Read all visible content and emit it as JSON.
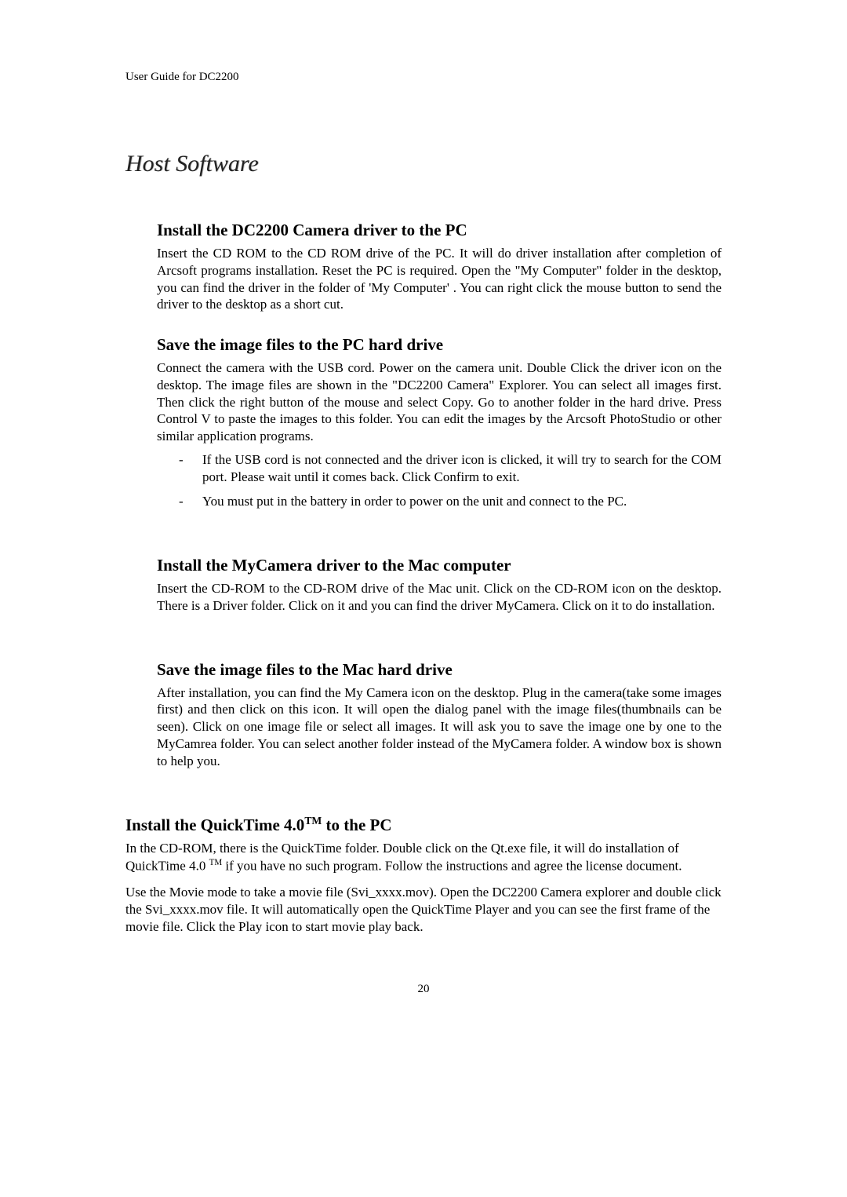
{
  "running_head": "User Guide for DC2200",
  "chapter_title": "Host Software",
  "sections": {
    "s1": {
      "heading": "Install the DC2200 Camera driver to the PC",
      "body": "Insert the CD ROM to the CD ROM drive of the PC. It will do driver installation after completion of Arcsoft programs installation. Reset the PC is required. Open the \"My Computer\" folder in the desktop, you can find the driver in the folder of 'My Computer' . You can right click the mouse button to send the driver to the desktop as a short cut."
    },
    "s2": {
      "heading": "Save the image files to the PC hard drive",
      "body": "Connect the camera with the USB cord. Power on the camera unit. Double Click the driver icon on the desktop. The image files are shown in the \"DC2200 Camera\" Explorer. You can select all images first. Then click the right button of the mouse and select Copy. Go to another folder in the hard drive. Press Control V to paste the images to this folder. You can edit the images by the Arcsoft PhotoStudio or other similar application programs.",
      "bullets": [
        "If the USB cord is not connected and the driver icon is clicked, it will try to search for the COM port. Please wait until it comes back. Click Confirm to exit.",
        "You must put in the battery in order to power on the unit and connect to the PC."
      ]
    },
    "s3": {
      "heading": "Install the MyCamera driver to the Mac computer",
      "body": "Insert the CD-ROM to the CD-ROM drive of the Mac unit. Click on the CD-ROM  icon on the desktop. There is a Driver folder. Click on it and you can find the driver  MyCamera. Click on it to do installation."
    },
    "s4": {
      "heading": "Save the image files to the Mac hard drive",
      "body": "After installation, you can find the My Camera icon on the desktop. Plug in the camera(take some images first) and then click on this icon. It will open the dialog panel with the image files(thumbnails can be seen). Click on one image file  or select all images. It will ask you to save the image one by one to the MyCamrea folder. You can select another folder instead of the MyCamera folder. A window box is shown to help you."
    },
    "s5": {
      "heading_prefix": "Install the QuickTime 4.0",
      "heading_sup": "TM",
      "heading_suffix": " to the PC",
      "body1_prefix": "In the CD-ROM, there is the QuickTime folder. Double click on the Qt.exe file, it will do installation of QuickTime 4.0 ",
      "body1_sup": "TM",
      "body1_suffix": " if you have no such program. Follow the instructions and agree the license document.",
      "body2": "Use the Movie mode to take a movie file (Svi_xxxx.mov). Open the DC2200 Camera explorer and double click the Svi_xxxx.mov file. It will automatically open the QuickTime Player and you can see the first frame of the movie file. Click the Play icon to start movie play back."
    }
  },
  "page_number": "20"
}
